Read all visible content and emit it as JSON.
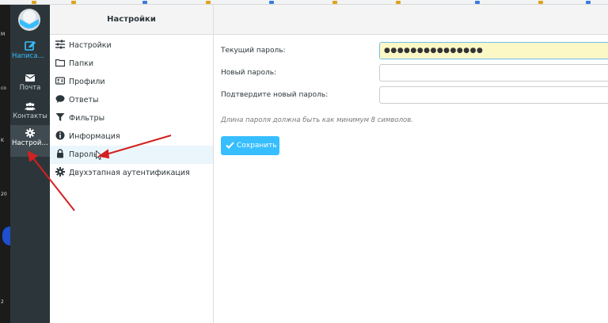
{
  "taskbar": {
    "items": [
      {
        "label": "Написать с...",
        "icon": "compose-icon"
      },
      {
        "label": "Почта",
        "icon": "mail-icon"
      },
      {
        "label": "Контакты",
        "icon": "contacts-icon"
      },
      {
        "label": "Настройки",
        "icon": "gear-icon"
      }
    ]
  },
  "settings_nav": {
    "title": "Настройки",
    "items": [
      {
        "label": "Настройки",
        "icon": "sliders-icon"
      },
      {
        "label": "Папки",
        "icon": "folder-icon"
      },
      {
        "label": "Профили",
        "icon": "id-card-icon"
      },
      {
        "label": "Ответы",
        "icon": "comment-icon"
      },
      {
        "label": "Фильтры",
        "icon": "filter-icon"
      },
      {
        "label": "Информация",
        "icon": "info-icon"
      },
      {
        "label": "Пароль",
        "icon": "lock-icon",
        "selected": true
      },
      {
        "label": "Двухэтапная аутентификация",
        "icon": "gear-icon"
      }
    ]
  },
  "password_form": {
    "current_label": "Текущий пароль:",
    "current_value": "●●●●●●●●●●●●●●●",
    "new_label": "Новый пароль:",
    "new_value": "",
    "confirm_label": "Подтвердите новый пароль:",
    "confirm_value": "",
    "hint": "Длина пароля должна быть как минимум 8 символов.",
    "save_label": "Сохранить"
  },
  "colors": {
    "taskbar_bg": "#2c363a",
    "accent": "#37beff",
    "focus_field": "#fbf8c6",
    "annotation": "#d42020"
  }
}
